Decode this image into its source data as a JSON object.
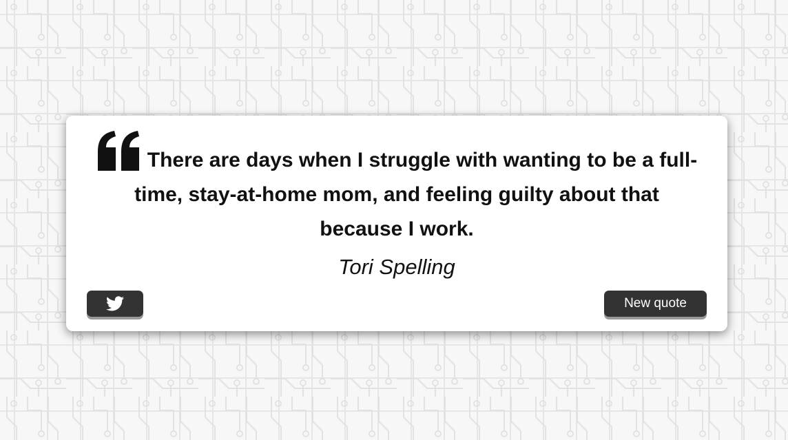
{
  "quote": {
    "text": "There are days when I struggle with wanting to be a full-time, stay-at-home mom, and feeling guilty about that because I work.",
    "author": "Tori Spelling"
  },
  "buttons": {
    "tweet_icon": "twitter-icon",
    "new_quote_label": "New quote"
  },
  "colors": {
    "button_bg": "#333333",
    "card_bg": "#ffffff",
    "pattern": "#e6e6e6"
  }
}
